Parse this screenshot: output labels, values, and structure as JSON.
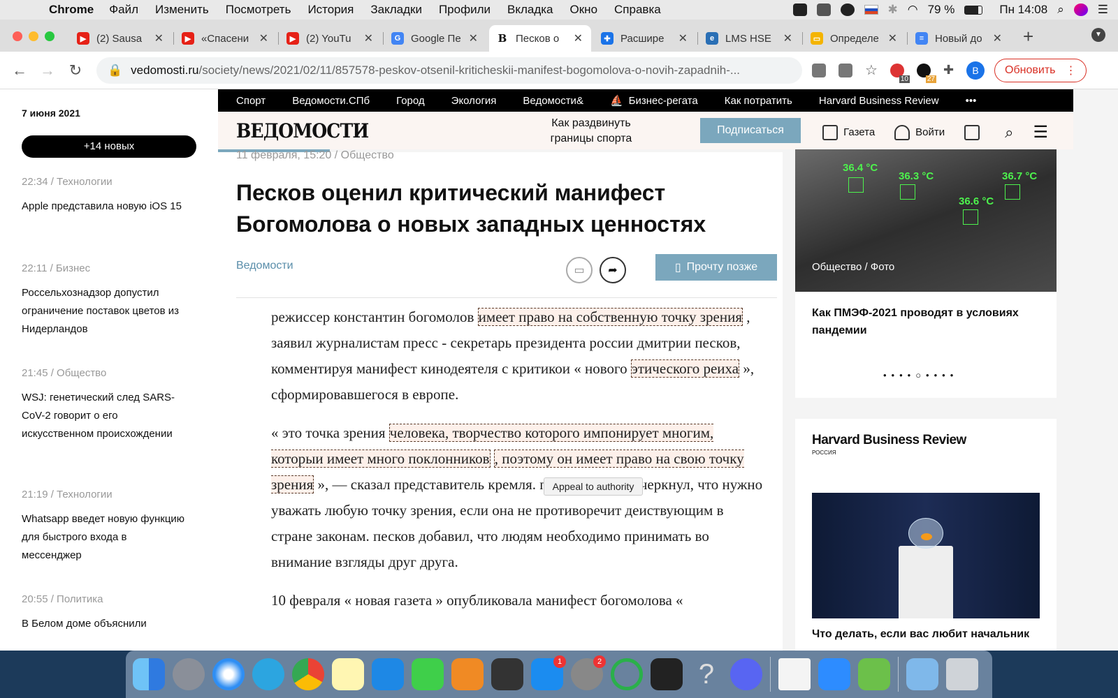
{
  "menubar": {
    "app": "Chrome",
    "items": [
      "Файл",
      "Изменить",
      "Посмотреть",
      "История",
      "Закладки",
      "Профили",
      "Вкладка",
      "Окно",
      "Справка"
    ],
    "battery": "79 %",
    "clock": "Пн 14:08"
  },
  "tabs": [
    {
      "title": "(2) Sausa",
      "color": "#e62117"
    },
    {
      "title": "«Спасени",
      "color": "#e62117"
    },
    {
      "title": "(2) YouTu",
      "color": "#e62117"
    },
    {
      "title": "Google Пе",
      "color": "#4285f4"
    },
    {
      "title": "Песков о",
      "color": "#111111"
    },
    {
      "title": "Расшире",
      "color": "#1a73e8"
    },
    {
      "title": "LMS HSE",
      "color": "#2a6fb5"
    },
    {
      "title": "Определе",
      "color": "#f4b400"
    },
    {
      "title": "Новый до",
      "color": "#4285f4"
    }
  ],
  "toolbar": {
    "url_host": "vedomosti.ru",
    "url_path": "/society/news/2021/02/11/857578-peskov-otsenil-kriticheskii-manifest-bogomolova-o-novih-zapadnih-...",
    "ext_badge1": "10",
    "ext_badge2": "27",
    "profile": "B",
    "update": "Обновить"
  },
  "sidebar": {
    "date": "7 июня 2021",
    "new_button": "+14 новых",
    "items": [
      {
        "meta": "22:34 / Технологии",
        "title": "Apple представила новую iOS 15"
      },
      {
        "meta": "22:11 / Бизнес",
        "title": "Россельхознадзор допустил ограничение поставок цветов из Нидерландов"
      },
      {
        "meta": "21:45 / Общество",
        "title": "WSJ: генетический след SARS-CoV-2 говорит о его искусственном происхождении"
      },
      {
        "meta": "21:19 / Технологии",
        "title": "Whatsapp введет новую функцию для быстрого входа в мессенджер"
      },
      {
        "meta": "20:55 / Политика",
        "title": "В Белом доме объяснили"
      }
    ]
  },
  "topnav": [
    "Спорт",
    "Ведомости.СПб",
    "Город",
    "Экология",
    "Ведомости&",
    "Бизнес-регата",
    "Как потратить",
    "Harvard Business Review",
    "•••"
  ],
  "header": {
    "logo": "ВЕДОМОСТИ",
    "promo": "Как раздвинуть границы спорта",
    "subscribe": "Подписаться",
    "newspaper": "Газета",
    "login": "Войти"
  },
  "article": {
    "meta": "11 февраля, 15:20 / Общество",
    "title": "Песков оценил критический манифест Богомолова о новых западных ценностях",
    "source": "Ведомости",
    "read_later": "Прочту позже",
    "p1": [
      "режиссер константин богомолов ",
      "имеет право на собственную точку зрения",
      " , заявил журналистам пресс - секретарь президента россии дмитрии песков, комментируя манифест кинодеятеля с критикои « нового ",
      "этического реиха",
      " », сформировавшегося в европе."
    ],
    "p2": [
      "« это точка зрения ",
      "человека, творчество которого импонирует многим, которыи имеет много поклонников",
      " ",
      ", поэтому он имеет право на свою точку зрения",
      " », — сказал представитель кремля. при этом он подчеркнул, что нужно уважать любую точку зрения, если она не противоречит деиствующим в стране законам. песков добавил, что людям необходимо принимать во внимание взгляды друг друга."
    ],
    "p3": "10 февраля « новая газета » опубликовала манифест богомолова «",
    "tooltip": "Appeal to authority"
  },
  "right": {
    "temps": [
      "36.4 °C",
      "36.3 °C",
      "36.7 °C",
      "36.6 °C"
    ],
    "photo_caption": "Общество / Фото",
    "card_title": "Как ПМЭФ-2021 проводят в условиях пандемии",
    "dots": "••••○••••",
    "hbr_logo": "Harvard Business Review",
    "hbr_sub": "РОССИЯ",
    "hbr_title": "Что делать, если вас любит начальник"
  },
  "dock": {
    "badge_appstore": "1",
    "badge_prefs": "2"
  }
}
